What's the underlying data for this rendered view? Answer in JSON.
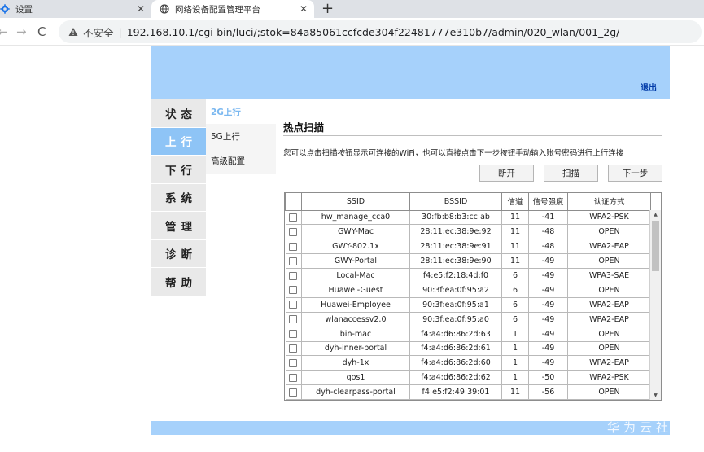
{
  "browser": {
    "tabs": [
      {
        "title": "设置",
        "icon": "gear-icon"
      },
      {
        "title": "网络设备配置管理平台",
        "icon": "globe-icon"
      }
    ],
    "new_tab": "+",
    "close": "✕",
    "nav": {
      "back": "←",
      "forward": "→",
      "reload": "C"
    },
    "security_label": "不安全",
    "separator": "|",
    "url": "192.168.10.1/cgi-bin/luci/;stok=84a85061ccfcde304f22481777e310b7/admin/020_wlan/001_2g/"
  },
  "header": {
    "logout": "退出"
  },
  "left_nav": [
    "状态",
    "上行",
    "下行",
    "系统",
    "管理",
    "诊断",
    "帮助"
  ],
  "left_nav_active": "上行",
  "sub_nav": [
    "2G上行",
    "5G上行",
    "高级配置"
  ],
  "sub_nav_active": "2G上行",
  "main": {
    "title": "热点扫描",
    "description": "您可以点击扫描按钮显示可连接的WiFi，也可以直接点击下一步按钮手动输入账号密码进行上行连接",
    "buttons": {
      "disconnect": "断开",
      "scan": "扫描",
      "next": "下一步"
    }
  },
  "table": {
    "headers": [
      "",
      "SSID",
      "BSSID",
      "信道",
      "信号强度",
      "认证方式"
    ],
    "rows": [
      {
        "ssid": "hw_manage_cca0",
        "bssid": "30:fb:b8:b3:cc:ab",
        "channel": "11",
        "signal": "-41",
        "auth": "WPA2-PSK"
      },
      {
        "ssid": "GWY-Mac",
        "bssid": "28:11:ec:38:9e:92",
        "channel": "11",
        "signal": "-48",
        "auth": "OPEN"
      },
      {
        "ssid": "GWY-802.1x",
        "bssid": "28:11:ec:38:9e:91",
        "channel": "11",
        "signal": "-48",
        "auth": "WPA2-EAP"
      },
      {
        "ssid": "GWY-Portal",
        "bssid": "28:11:ec:38:9e:90",
        "channel": "11",
        "signal": "-49",
        "auth": "OPEN"
      },
      {
        "ssid": "Local-Mac",
        "bssid": "f4:e5:f2:18:4d:f0",
        "channel": "6",
        "signal": "-49",
        "auth": "WPA3-SAE"
      },
      {
        "ssid": "Huawei-Guest",
        "bssid": "90:3f:ea:0f:95:a2",
        "channel": "6",
        "signal": "-49",
        "auth": "OPEN"
      },
      {
        "ssid": "Huawei-Employee",
        "bssid": "90:3f:ea:0f:95:a1",
        "channel": "6",
        "signal": "-49",
        "auth": "WPA2-EAP"
      },
      {
        "ssid": "wlanaccessv2.0",
        "bssid": "90:3f:ea:0f:95:a0",
        "channel": "6",
        "signal": "-49",
        "auth": "WPA2-EAP"
      },
      {
        "ssid": "bin-mac",
        "bssid": "f4:a4:d6:86:2d:63",
        "channel": "1",
        "signal": "-49",
        "auth": "OPEN"
      },
      {
        "ssid": "dyh-inner-portal",
        "bssid": "f4:a4:d6:86:2d:61",
        "channel": "1",
        "signal": "-49",
        "auth": "OPEN"
      },
      {
        "ssid": "dyh-1x",
        "bssid": "f4:a4:d6:86:2d:60",
        "channel": "1",
        "signal": "-49",
        "auth": "WPA2-EAP"
      },
      {
        "ssid": "qos1",
        "bssid": "f4:a4:d6:86:2d:62",
        "channel": "1",
        "signal": "-50",
        "auth": "WPA2-PSK"
      },
      {
        "ssid": "dyh-clearpass-portal",
        "bssid": "f4:e5:f2:49:39:01",
        "channel": "11",
        "signal": "-56",
        "auth": "OPEN"
      }
    ]
  },
  "watermark": "华为云社",
  "colors": {
    "banner": "#a6d1fb",
    "nav_active": "#8ec4f6",
    "logout": "#003aa8",
    "subnav_active": "#7bb8f0"
  }
}
